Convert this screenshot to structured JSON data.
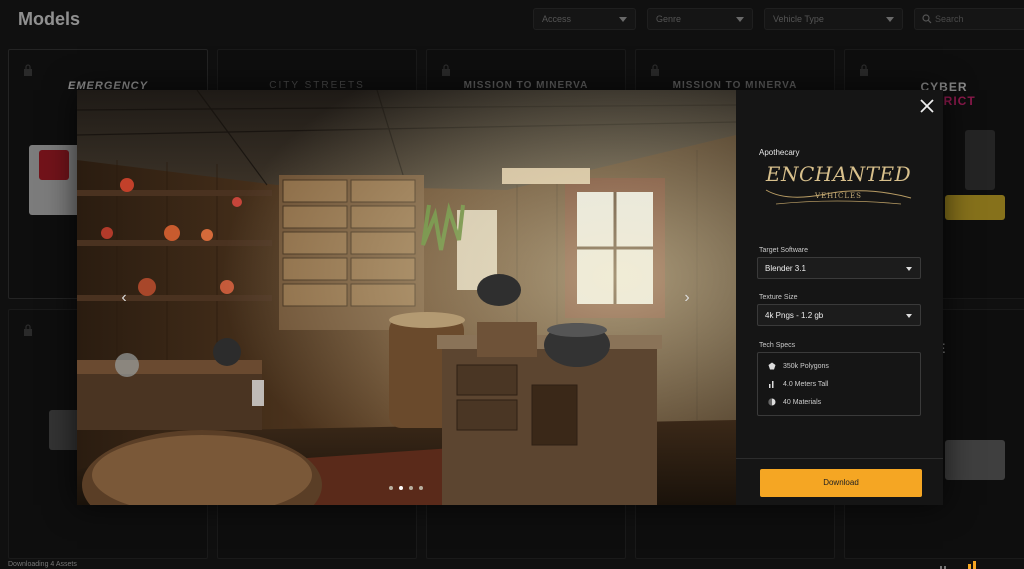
{
  "header": {
    "title": "Models",
    "filters": [
      {
        "label": "Access"
      },
      {
        "label": "Genre"
      },
      {
        "label": "Vehicle Type"
      }
    ],
    "search": {
      "placeholder": "Search"
    }
  },
  "cards": [
    {
      "logo": "EMERGENCY",
      "locked": true
    },
    {
      "logo": "CITY STREETS",
      "locked": false
    },
    {
      "logo": "MISSION TO MINERVA",
      "locked": true
    },
    {
      "logo": "MISSION TO MINERVA",
      "locked": true
    },
    {
      "logo_main": "CYBER",
      "logo_accent": "DISTRICT",
      "locked": true
    },
    {
      "logo": "",
      "locked": true
    },
    {
      "logo": "FARE",
      "locked": false
    }
  ],
  "footer": {
    "status": "Downloading 4 Assets"
  },
  "modal": {
    "category": "Apothecary",
    "brand": {
      "title": "ENCHANTED",
      "subtitle": "VEHICLES"
    },
    "target_software": {
      "label": "Target Software",
      "value": "Blender 3.1"
    },
    "texture_size": {
      "label": "Texture Size",
      "value": "4k Pngs - 1.2 gb"
    },
    "tech_specs": {
      "label": "Tech Specs",
      "items": [
        {
          "icon": "polygon-icon",
          "text": "350k Polygons"
        },
        {
          "icon": "height-icon",
          "text": "4.0 Meters Tall"
        },
        {
          "icon": "materials-icon",
          "text": "40 Materials"
        }
      ]
    },
    "download_label": "Download",
    "carousel": {
      "slide_count": 4,
      "active_index": 1
    }
  },
  "colors": {
    "accent": "#f5a623",
    "background": "#1a1a1a",
    "panel": "#151515",
    "brand_gold": "#d8c08c",
    "cyber_pink": "#e0287a"
  }
}
